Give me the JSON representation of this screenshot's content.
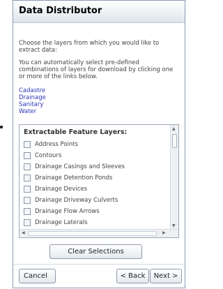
{
  "panel": {
    "title": "Data Distributor",
    "intro": "Choose the layers from which you would like to extract data:",
    "auto_select": "You can automatically select pre-defined combinations of layers for download by clicking one or more of the links below.",
    "preset_links": [
      "Cadastre",
      "Drainage",
      "Sanitary",
      "Water"
    ],
    "link_color": "#2a35b8"
  },
  "layers": {
    "header": "Extractable Feature Layers:",
    "items": [
      "Address Points",
      "Contours",
      "Drainage Casings and Sleeves",
      "Drainage Detention Ponds",
      "Drainage Devices",
      "Drainage Driveway Culverts",
      "Drainage Flow Arrows",
      "Drainage Laterals"
    ]
  },
  "buttons": {
    "clear": "Clear Selections",
    "cancel": "Cancel",
    "back": "< Back",
    "next": "Next >"
  }
}
